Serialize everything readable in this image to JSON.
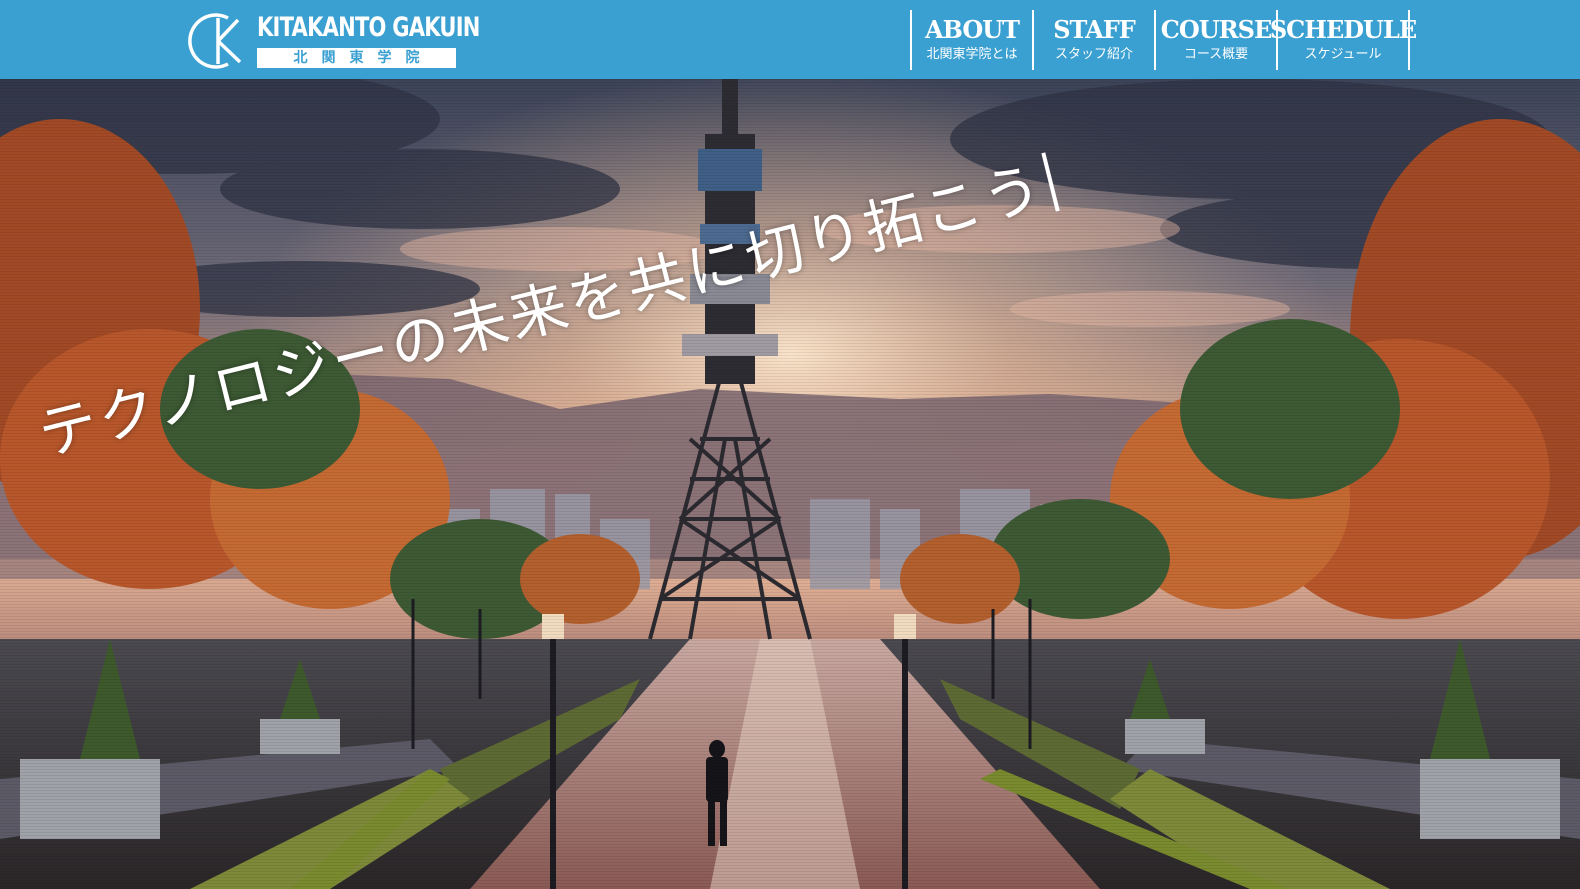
{
  "header": {
    "logo_en": "KITAKANTO GAKUIN",
    "logo_jp": "北関東学院",
    "logo_mark_icon": "ck-monogram-icon"
  },
  "nav": [
    {
      "en": "ABOUT",
      "jp": "北関東学院とは"
    },
    {
      "en": "STAFF",
      "jp": "スタッフ紹介"
    },
    {
      "en": "COURSE",
      "jp": "コース概要"
    },
    {
      "en": "SCHEDULE",
      "jp": "スケジュール"
    }
  ],
  "hero": {
    "catchphrase": "テクノロジーの未来を共に切り拓こう"
  },
  "colors": {
    "header_bg": "#3a9fd1",
    "text": "#ffffff"
  }
}
